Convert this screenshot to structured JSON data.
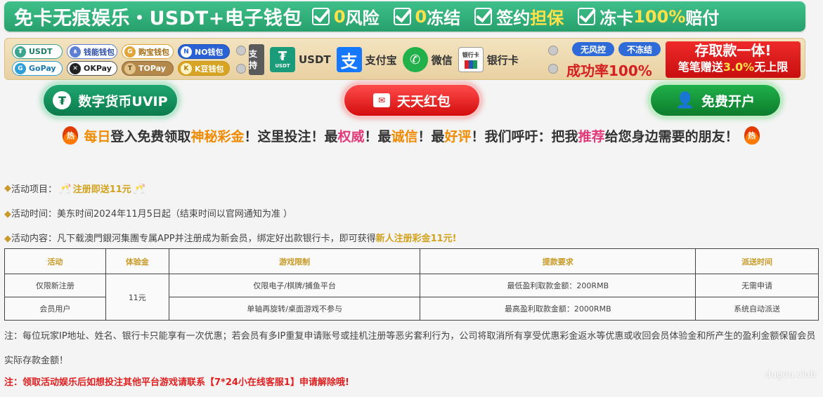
{
  "banner": {
    "title": "免卡无痕娱乐・USDT+电子钱包",
    "features": [
      {
        "pre": "",
        "hl": "0",
        "post": "风险"
      },
      {
        "pre": "",
        "hl": "0",
        "post": "冻结"
      },
      {
        "pre": "签约",
        "hl": "担保",
        "post": ""
      },
      {
        "pre": "冻卡",
        "hl": "100%",
        "post": "赔付"
      }
    ]
  },
  "wallets": [
    {
      "id": "usdt",
      "icon": "₮",
      "label": "USDT"
    },
    {
      "id": "gopay",
      "icon": "G",
      "label": "GoPay"
    },
    {
      "id": "jn",
      "icon": "∧",
      "label": "钱能钱包"
    },
    {
      "id": "ok",
      "icon": "✕",
      "label": "OKPay"
    },
    {
      "id": "gb",
      "icon": "G",
      "label": "购宝钱包"
    },
    {
      "id": "top",
      "icon": "T",
      "label": "TOPay"
    },
    {
      "id": "no",
      "icon": "N",
      "label": "NO钱包"
    },
    {
      "id": "k",
      "icon": "K",
      "label": "K豆钱包"
    }
  ],
  "methods": {
    "support": "支持",
    "usdt_icon": "₮",
    "usdt_small": "USDT",
    "usdt": "USDT",
    "alipay_icon": "支",
    "alipay": "支付宝",
    "wechat_icon": "✆",
    "wechat": "微信",
    "bank_icon": "银行卡",
    "bank": "银行卡"
  },
  "risk": {
    "tag1": "无风控",
    "tag2": "不冻结",
    "rate_prefix": "成功率",
    "rate": "100%"
  },
  "deposit_promo": {
    "line1": "存取款一体!",
    "line2_pre": "笔笔赠送",
    "line2_hl": "3.0%",
    "line2_post": "无上限"
  },
  "buttons": {
    "vip": {
      "icon": "₮",
      "label": "数字货币UVIP"
    },
    "redpacket": {
      "icon": "✉",
      "label": "天天红包"
    },
    "open": {
      "icon": "👤",
      "label": "免费开户"
    }
  },
  "slogan": {
    "fire": "热",
    "parts": [
      {
        "t": "每日",
        "c": "orange"
      },
      {
        "t": "登入免费领取",
        "c": ""
      },
      {
        "t": "神秘彩金",
        "c": "orange"
      },
      {
        "t": "！这里投注！最",
        "c": ""
      },
      {
        "t": "权威",
        "c": "pink"
      },
      {
        "t": "！最",
        "c": ""
      },
      {
        "t": "诚信",
        "c": "orange"
      },
      {
        "t": "！最",
        "c": ""
      },
      {
        "t": "好评",
        "c": "orange"
      },
      {
        "t": "！我们呼吁：把我",
        "c": ""
      },
      {
        "t": "推荐",
        "c": "pink"
      },
      {
        "t": "给您身边需要的朋友！",
        "c": ""
      }
    ]
  },
  "activity": {
    "diamond": "◆",
    "project_label": "活动项目：",
    "project_value": "注册即送11元",
    "time_label": "活动时间：",
    "time_value": "美东时间2024年11月5日起（结束时间以官网通知为准 ）",
    "content_label": "活动内容：",
    "content_value": "凡下载澳門銀河集團专属APP并注册成为新会员，绑定好出款银行卡，即可获得",
    "content_hl": "新人注册彩金11元!"
  },
  "table": {
    "headers": [
      "活动",
      "体验金",
      "游戏限制",
      "提款要求",
      "派送时间"
    ],
    "row1": {
      "activity": "仅限新注册",
      "amount": "11元",
      "game": "仅限电子/棋牌/捕鱼平台",
      "withdraw": "最低盈利取款金额：200RMB",
      "delivery": "无需申请"
    },
    "row2": {
      "activity": "会员用户",
      "game": "单轴再旋转/桌面游戏不参与",
      "withdraw": "最高盈利取款金额：2000RMB",
      "delivery": "系统自动派送"
    }
  },
  "notes": {
    "note1": "注：每位玩家IP地址、姓名、银行卡只能享有一次优惠；若会员有多IP重复申请账号或挂机注册等恶劣套利行为，公司将取消所有享受优惠彩金返水等优惠或收回会员体验金和所产生的盈利金额保留会员实际存款金额！",
    "note2": "注：领取活动娱乐后如想投注其他平台游戏请联系【7*24小在线客服1】申请解除哦!"
  },
  "watermark": "dugou.club",
  "colors": {
    "accent_green": "#27a06c",
    "accent_red": "#d40d0d",
    "gold": "#d2a21c"
  }
}
